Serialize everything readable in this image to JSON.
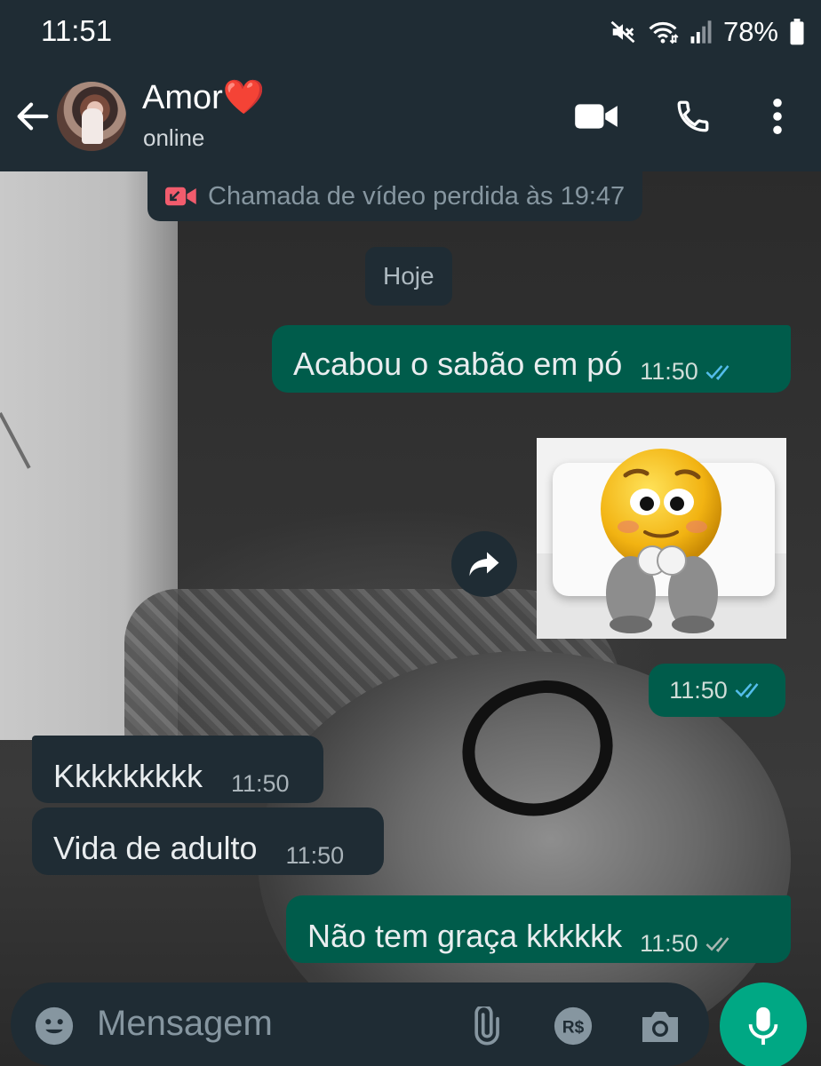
{
  "status_bar": {
    "time": "11:51",
    "battery": "78%",
    "icons": [
      "mute-icon",
      "wifi-icon",
      "signal-icon",
      "battery-icon"
    ]
  },
  "header": {
    "contact_name": "Amor❤️",
    "contact_status": "online",
    "icons": [
      "back-arrow-icon",
      "video-call-icon",
      "phone-icon",
      "more-options-icon"
    ]
  },
  "chat": {
    "missed_call": "Chamada de vídeo perdida às 19:47",
    "day_separator": "Hoje",
    "messages": [
      {
        "direction": "out",
        "text": "Acabou o sabão em pó",
        "time": "11:50",
        "ticks": "read"
      },
      {
        "direction": "out",
        "type": "sticker",
        "time": "11:50",
        "ticks": "read"
      },
      {
        "direction": "in",
        "text": "Kkkkkkkkk",
        "time": "11:50"
      },
      {
        "direction": "in",
        "text": "Vida de adulto",
        "time": "11:50"
      },
      {
        "direction": "out",
        "text": "Não tem graça kkkkkk",
        "time": "11:50",
        "ticks": "delivered"
      }
    ]
  },
  "input": {
    "placeholder": "Mensagem",
    "icons": [
      "emoji-icon",
      "attach-icon",
      "payment-icon",
      "camera-icon",
      "mic-icon"
    ],
    "payment_label": "R$"
  },
  "colors": {
    "header_bg": "#1f2c34",
    "outgoing_bubble": "#005c4b",
    "incoming_bubble": "#1f2c34",
    "read_tick": "#53bdeb",
    "mic_button": "#00a884",
    "missed_call_icon": "#f15c6d"
  }
}
